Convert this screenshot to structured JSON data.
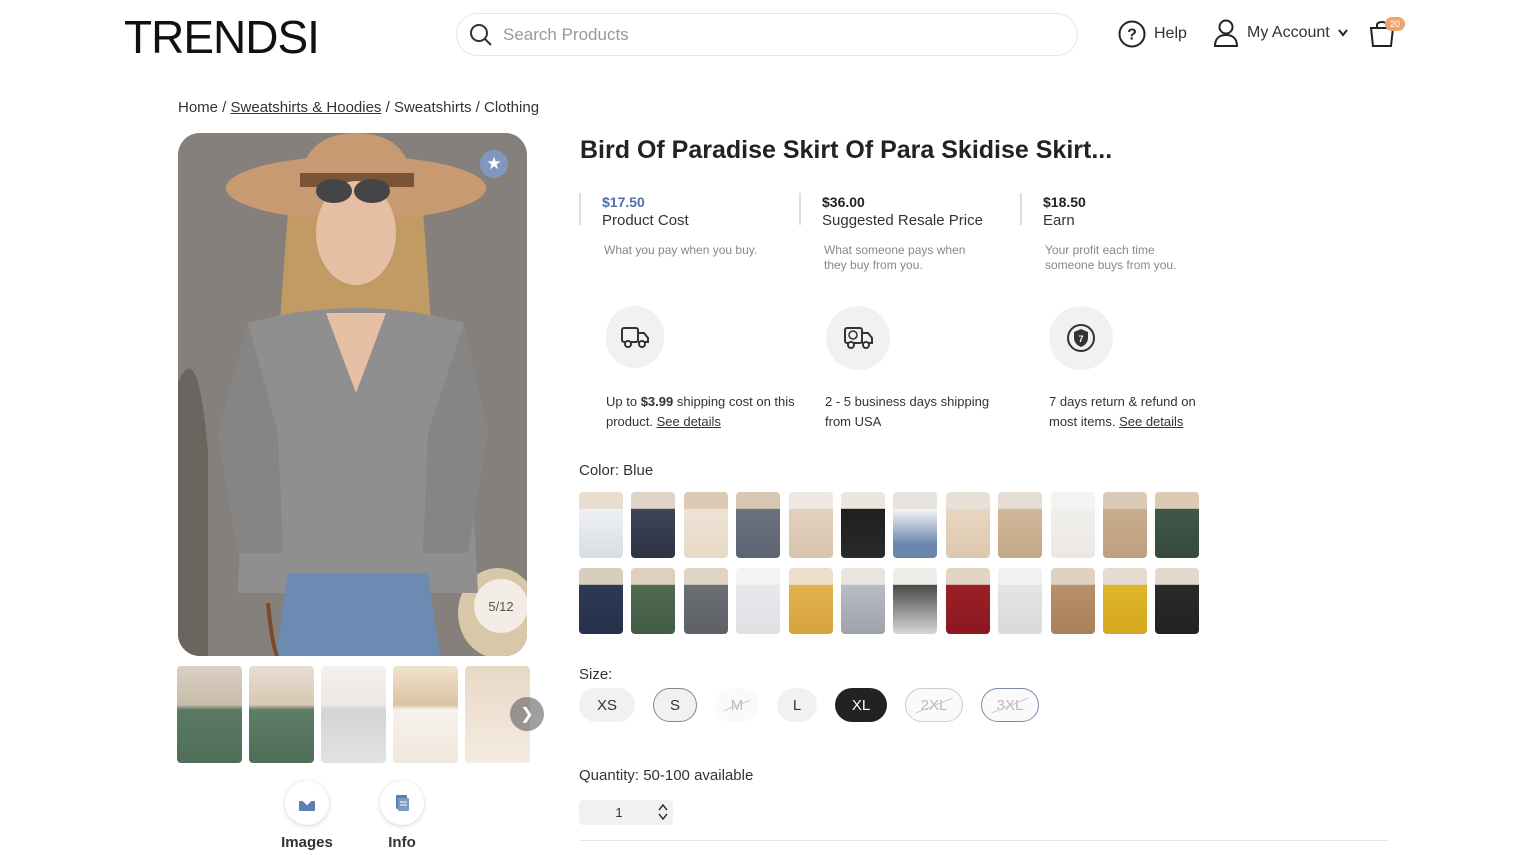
{
  "header": {
    "logo": "TRENDSI",
    "search_placeholder": "Search Products",
    "help_label": "Help",
    "account_label": "My Account",
    "cart_count": "20",
    "icons": [
      "search-icon",
      "help-icon",
      "user-icon",
      "chevron-down-icon",
      "cart-icon"
    ]
  },
  "breadcrumb": {
    "home": "Home",
    "sep": " / ",
    "cat1": "Sweatshirts & Hoodies",
    "cat2": "Sweatshirts",
    "cat3": "Clothing"
  },
  "gallery": {
    "counter": "5/12",
    "images_label": "Images",
    "info_label": "Info"
  },
  "product": {
    "title": "Bird Of Paradise Skirt Of Para Skidise Skirt...",
    "prices": [
      {
        "value": "$17.50",
        "name": "Product Cost",
        "desc": "What you pay when you buy.",
        "color": "#4f6fa8"
      },
      {
        "value": "$36.00",
        "name": "Suggested Resale Price",
        "desc": "What someone pays when they buy from you.",
        "color": "#222222"
      },
      {
        "value": "$18.50",
        "name": "Earn",
        "desc": "Your profit each time someone buys from you.",
        "color": "#222222"
      }
    ],
    "features": [
      {
        "pre": "Up to ",
        "bold": "$3.99",
        "post": " shipping cost on this product. ",
        "link": "See details"
      },
      {
        "text": "2 - 5 business days shipping from USA"
      },
      {
        "text": "7 days return & refund on most items. ",
        "link": "See details"
      }
    ],
    "color_label": "Color: Blue",
    "size_label": "Size:",
    "sizes": [
      "XS",
      "S",
      "M",
      "L",
      "XL",
      "2XL",
      "3XL"
    ],
    "selected_size": "XL",
    "quantity_label": "Quantity: 50-100 available",
    "quantity_value": "1"
  },
  "colors": {
    "accent": "#4f6fa8",
    "cart_badge": "#f0a36a",
    "selected_size_bg": "#222222"
  }
}
